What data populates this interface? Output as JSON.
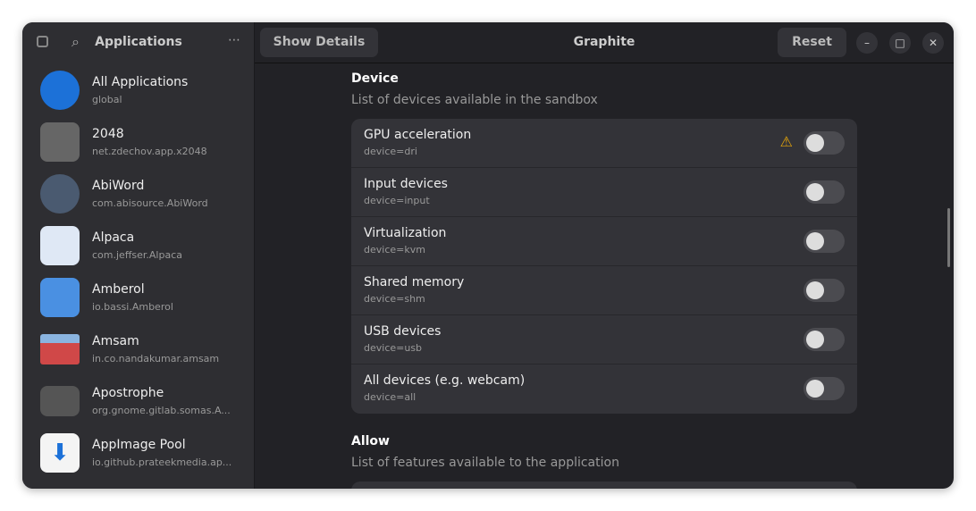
{
  "sidebar": {
    "title": "Applications",
    "items": [
      {
        "name": "All Applications",
        "id": "global"
      },
      {
        "name": "2048",
        "id": "net.zdechov.app.x2048"
      },
      {
        "name": "AbiWord",
        "id": "com.abisource.AbiWord"
      },
      {
        "name": "Alpaca",
        "id": "com.jeffser.Alpaca"
      },
      {
        "name": "Amberol",
        "id": "io.bassi.Amberol"
      },
      {
        "name": "Amsam",
        "id": "in.co.nandakumar.amsam"
      },
      {
        "name": "Apostrophe",
        "id": "org.gnome.gitlab.somas.A..."
      },
      {
        "name": "AppImage Pool",
        "id": "io.github.prateekmedia.ap..."
      }
    ]
  },
  "header": {
    "show_details": "Show Details",
    "title": "Graphite",
    "reset": "Reset"
  },
  "device": {
    "title": "Device",
    "subtitle": "List of devices available in the sandbox",
    "rows": [
      {
        "name": "GPU acceleration",
        "key": "device=dri",
        "enabled": false,
        "warning": true
      },
      {
        "name": "Input devices",
        "key": "device=input",
        "enabled": false
      },
      {
        "name": "Virtualization",
        "key": "device=kvm",
        "enabled": false
      },
      {
        "name": "Shared memory",
        "key": "device=shm",
        "enabled": false
      },
      {
        "name": "USB devices",
        "key": "device=usb",
        "enabled": false
      },
      {
        "name": "All devices (e.g. webcam)",
        "key": "device=all",
        "enabled": false
      }
    ]
  },
  "allow": {
    "title": "Allow",
    "subtitle": "List of features available to the application"
  }
}
